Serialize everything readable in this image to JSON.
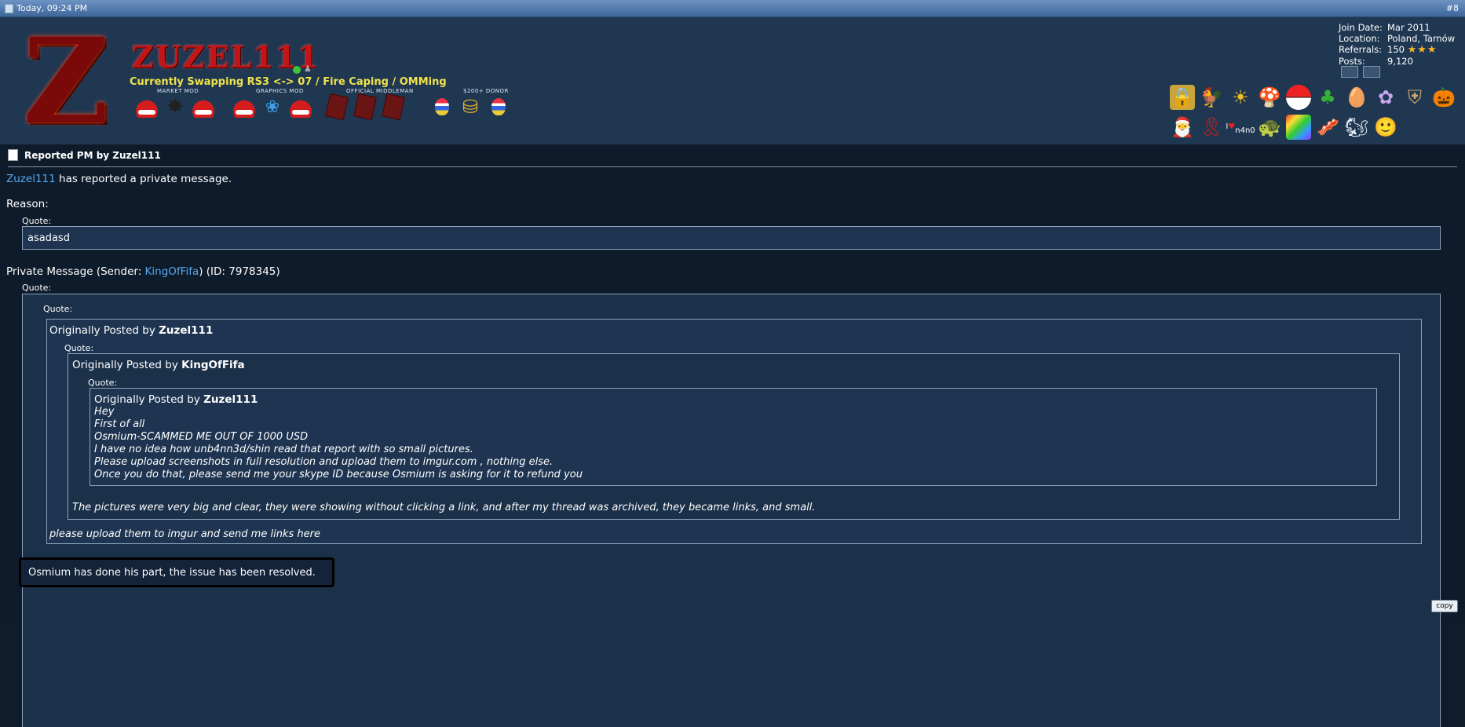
{
  "post_header": {
    "date": "Today, 09:24 PM",
    "post_number": "#8"
  },
  "user": {
    "name": "ZUZEL111",
    "title": "Currently Swapping RS3 <-> 07 / Fire Caping / OMMing",
    "rank_labels": [
      "MARKET MOD",
      "GRAPHICS MOD",
      "OFFICIAL MIDDLEMAN",
      "$200+ DONOR"
    ],
    "info": {
      "join_label": "Join Date:",
      "join_value": "Mar 2011",
      "location_label": "Location:",
      "location_value": "Poland, Tarnów",
      "referrals_label": "Referrals:",
      "referrals_value": "150",
      "referrals_stars": "★★★",
      "posts_label": "Posts:",
      "posts_value": "9,120"
    },
    "award_icons_row1": [
      "lock-icon",
      "rooster-icon",
      "sun-13-icon",
      "mushroom-icon",
      "pokeball-icon",
      "clover-icon",
      "easter-egg-icon",
      "flower-icon",
      "shield-icon",
      "pumpkin-icon"
    ],
    "award_icons_row2": [
      "santa-icon",
      "ribbon-icon",
      "i-heart-n4n0-icon",
      "turtle-icon",
      "rainbow-icon",
      "bacon-icon",
      "squirrel-icon",
      "face-icon"
    ]
  },
  "report": {
    "title": "Reported PM by Zuzel111",
    "reporter": "Zuzel111",
    "reported_text": " has reported a private message.",
    "reason_label": "Reason:",
    "quote_label": "Quote:",
    "reason_text": "asadasd",
    "pm_prefix": "Private Message (Sender: ",
    "pm_sender": "KingOfFifa",
    "pm_suffix": ") (ID: 7978345)",
    "orig_posted_by": "Originally Posted by ",
    "q1_author": "Zuzel111",
    "q2_author": "KingOfFifa",
    "q3_author": "Zuzel111",
    "q3_lines": {
      "l1": "Hey",
      "l2": "First of all",
      "l3": "Osmium-SCAMMED ME OUT OF 1000 USD",
      "l4": "I have no idea how unb4nn3d/shin read that report with so small pictures.",
      "l5": "Please upload screenshots in full resolution and upload them to imgur.com , nothing else.",
      "l6": "Once you do that, please send me your skype ID because Osmium is asking for it to refund you"
    },
    "q2_reply": "The pictures were very big and clear, they were showing without clicking a link, and after my thread was archived, they became links, and small.",
    "q1_reply": "please upload them to imgur and send me links here",
    "resolution": "Osmium has done his part, the issue has been resolved.",
    "copy_button": "copy"
  }
}
